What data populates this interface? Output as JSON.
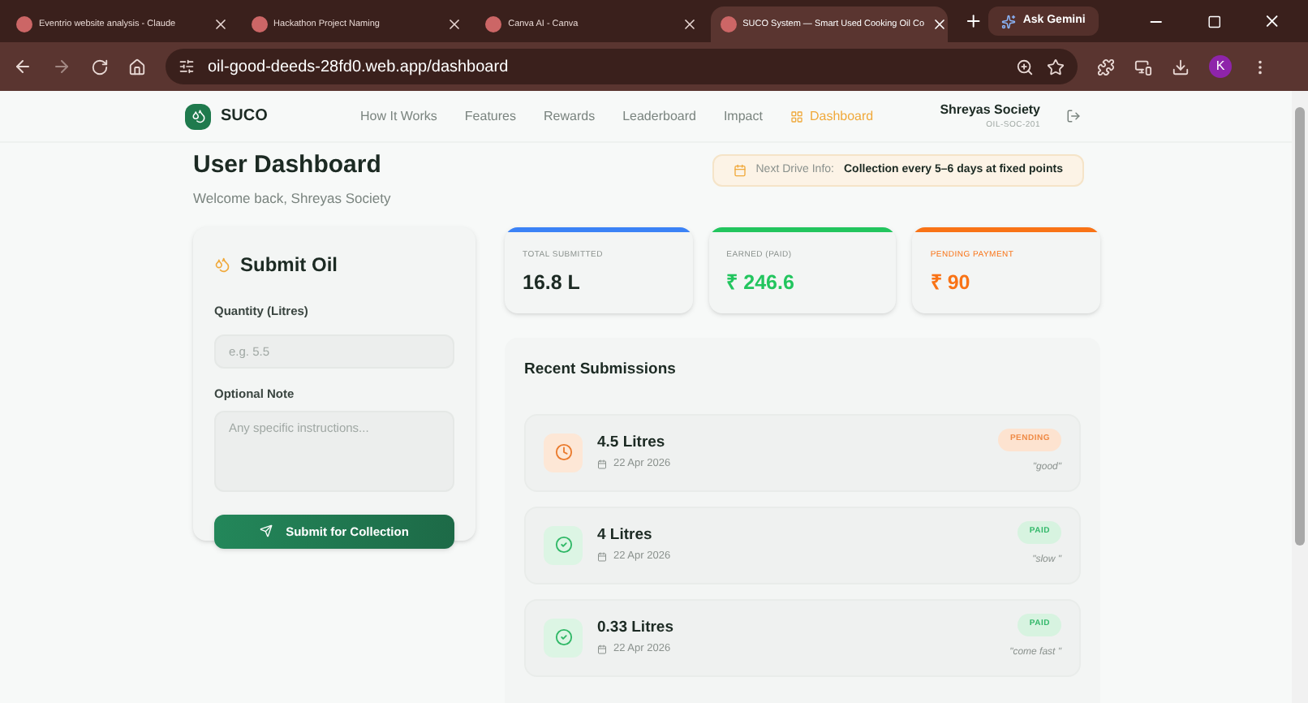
{
  "browser": {
    "tabs": [
      {
        "title": "Eventrio website analysis - Claude",
        "selected": false
      },
      {
        "title": "Hackathon Project Naming",
        "selected": false
      },
      {
        "title": "Canva AI - Canva",
        "selected": false
      },
      {
        "title": "SUCO System — Smart Used Cooking Oil Co",
        "selected": true
      }
    ],
    "gemini": "Ask Gemini",
    "url": "oil-good-deeds-28fd0.web.app/dashboard",
    "profile": "K"
  },
  "nav": {
    "logo": "SUCO",
    "links": [
      {
        "label": "How It Works",
        "selected": false
      },
      {
        "label": "Features",
        "selected": false
      },
      {
        "label": "Rewards",
        "selected": false
      },
      {
        "label": "Leaderboard",
        "selected": false
      },
      {
        "label": "Impact",
        "selected": false
      },
      {
        "label": "Dashboard",
        "selected": true
      }
    ],
    "user": "Shreyas Society",
    "user_id": "OIL-SOC-201"
  },
  "header": {
    "title": "User Dashboard",
    "subtitle": "Welcome back, Shreyas Society",
    "drive_label": "Next Drive Info:",
    "drive_value": "Collection every 5–6 days at fixed points"
  },
  "form": {
    "title": "Submit Oil",
    "quantity_label": "Quantity (Litres)",
    "quantity_placeholder": "e.g. 5.5",
    "note_label": "Optional Note",
    "note_placeholder": "Any specific instructions...",
    "submit": "Submit for Collection"
  },
  "stats": [
    {
      "label": "TOTAL SUBMITTED",
      "value": "16.8 L",
      "color": "#3b82f6"
    },
    {
      "label": "EARNED (PAID)",
      "value": "₹ 246.6",
      "color": "#22c55e"
    },
    {
      "label": "PENDING PAYMENT",
      "value": "₹ 90",
      "color": "#f97316"
    }
  ],
  "recent": {
    "title": "Recent Submissions",
    "items": [
      {
        "kind": "pending",
        "amount": "4.5 Litres",
        "date": "22 Apr 2026",
        "status": "PENDING",
        "note": "\"good\""
      },
      {
        "kind": "paid",
        "amount": "4 Litres",
        "date": "22 Apr 2026",
        "status": "PAID",
        "note": "\"slow \""
      },
      {
        "kind": "paid",
        "amount": "0.33 Litres",
        "date": "22 Apr 2026",
        "status": "PAID",
        "note": "\"come fast \""
      }
    ]
  }
}
